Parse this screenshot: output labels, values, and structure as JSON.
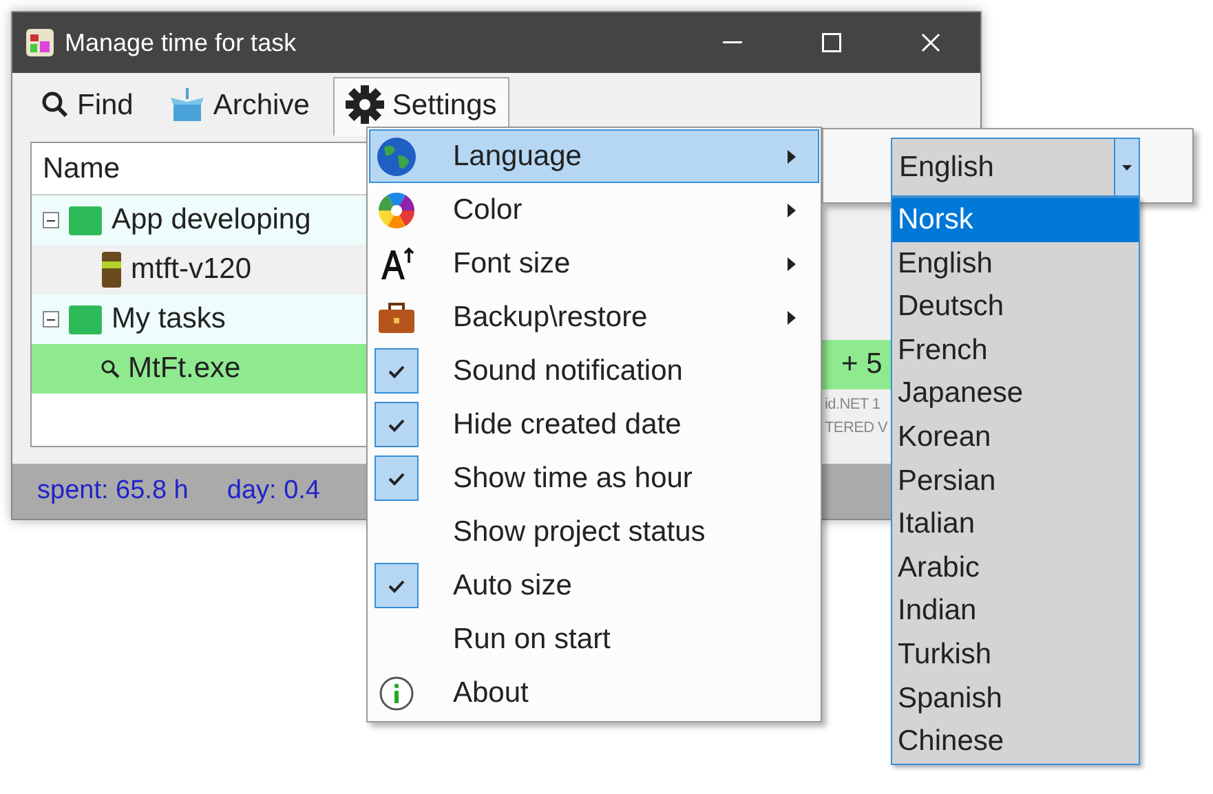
{
  "window": {
    "title": "Manage time for task"
  },
  "toolbar": [
    {
      "label": "Find",
      "kind": "search",
      "selected": false
    },
    {
      "label": "Archive",
      "kind": "box",
      "selected": false
    },
    {
      "label": "Settings",
      "kind": "gear",
      "selected": true
    }
  ],
  "grid": {
    "columns": [
      "Name"
    ],
    "rows": [
      {
        "name": "App developing",
        "kind": "folder",
        "expanded": true,
        "selected": false,
        "children": [
          {
            "name": "mtft-v120",
            "kind": "book",
            "selected": false
          }
        ]
      },
      {
        "name": "My tasks",
        "kind": "folder",
        "expanded": true,
        "selected": false,
        "children": [
          {
            "name": "MtFt.exe",
            "kind": "search",
            "selected": true,
            "cell_2": "+ 5"
          }
        ]
      }
    ],
    "notice": [
      "id.NET 1",
      "TERED V"
    ]
  },
  "status_bar": [
    "spent: 65.8 h",
    "day: 0.4"
  ],
  "settings_menu": [
    {
      "label": "Language",
      "kind": "globe",
      "submenu": true,
      "selected": true
    },
    {
      "label": "Color",
      "kind": "palette",
      "submenu": true,
      "selected": false
    },
    {
      "label": "Font size",
      "kind": "font",
      "submenu": true,
      "selected": false
    },
    {
      "label": "Backup\\restore",
      "kind": "briefcase",
      "submenu": true,
      "selected": false
    },
    {
      "label": "Sound notification",
      "kind": "check",
      "checked": true,
      "selected": false
    },
    {
      "label": "Hide created date",
      "kind": "check",
      "checked": true,
      "selected": false
    },
    {
      "label": "Show time as hour",
      "kind": "check",
      "checked": true,
      "selected": false
    },
    {
      "label": "Show project status",
      "kind": "check",
      "checked": false,
      "selected": false
    },
    {
      "label": "Auto size",
      "kind": "check",
      "checked": true,
      "selected": false
    },
    {
      "label": "Run on start",
      "kind": "check",
      "checked": false,
      "selected": false
    },
    {
      "label": "About",
      "kind": "info",
      "selected": false
    }
  ],
  "language": {
    "value": "English",
    "options": [
      {
        "label": "Norsk",
        "highlighted": true
      },
      {
        "label": "English",
        "highlighted": false
      },
      {
        "label": "Deutsch",
        "highlighted": false
      },
      {
        "label": "French",
        "highlighted": false
      },
      {
        "label": "Japanese",
        "highlighted": false
      },
      {
        "label": "Korean",
        "highlighted": false
      },
      {
        "label": "Persian",
        "highlighted": false
      },
      {
        "label": "Italian",
        "highlighted": false
      },
      {
        "label": "Arabic",
        "highlighted": false
      },
      {
        "label": "Indian",
        "highlighted": false
      },
      {
        "label": "Turkish",
        "highlighted": false
      },
      {
        "label": "Spanish",
        "highlighted": false
      },
      {
        "label": "Chinese",
        "highlighted": false
      }
    ]
  }
}
